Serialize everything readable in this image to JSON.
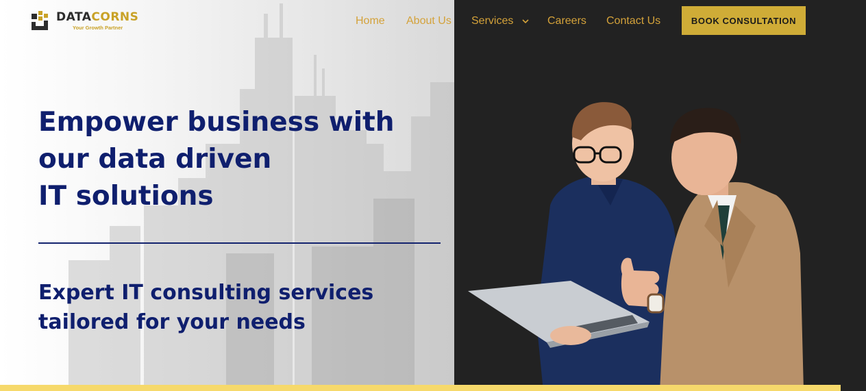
{
  "brand": {
    "name_part1": "DATA",
    "name_part2": "CORNS",
    "tagline": "Your Growth Partner"
  },
  "nav": {
    "items": [
      {
        "label": "Home"
      },
      {
        "label": "About Us"
      },
      {
        "label": "Services"
      },
      {
        "label": "Careers"
      },
      {
        "label": "Contact Us"
      }
    ],
    "cta_label": "BOOK CONSULTATION"
  },
  "hero": {
    "headline_lines": [
      "Empower business with",
      "our data driven",
      "IT solutions"
    ],
    "subheadline_lines": [
      "Expert IT consulting services",
      "tailored for your needs"
    ]
  },
  "icons": {
    "logo": "datacorns-logo-icon",
    "services_dropdown": "chevron-down-icon"
  },
  "colors": {
    "nav_text": "#d4a23a",
    "cta_background": "#cfac37",
    "headline": "#0f1f6e",
    "dark_panel": "#222222",
    "bottom_bar": "#f6d96b"
  }
}
